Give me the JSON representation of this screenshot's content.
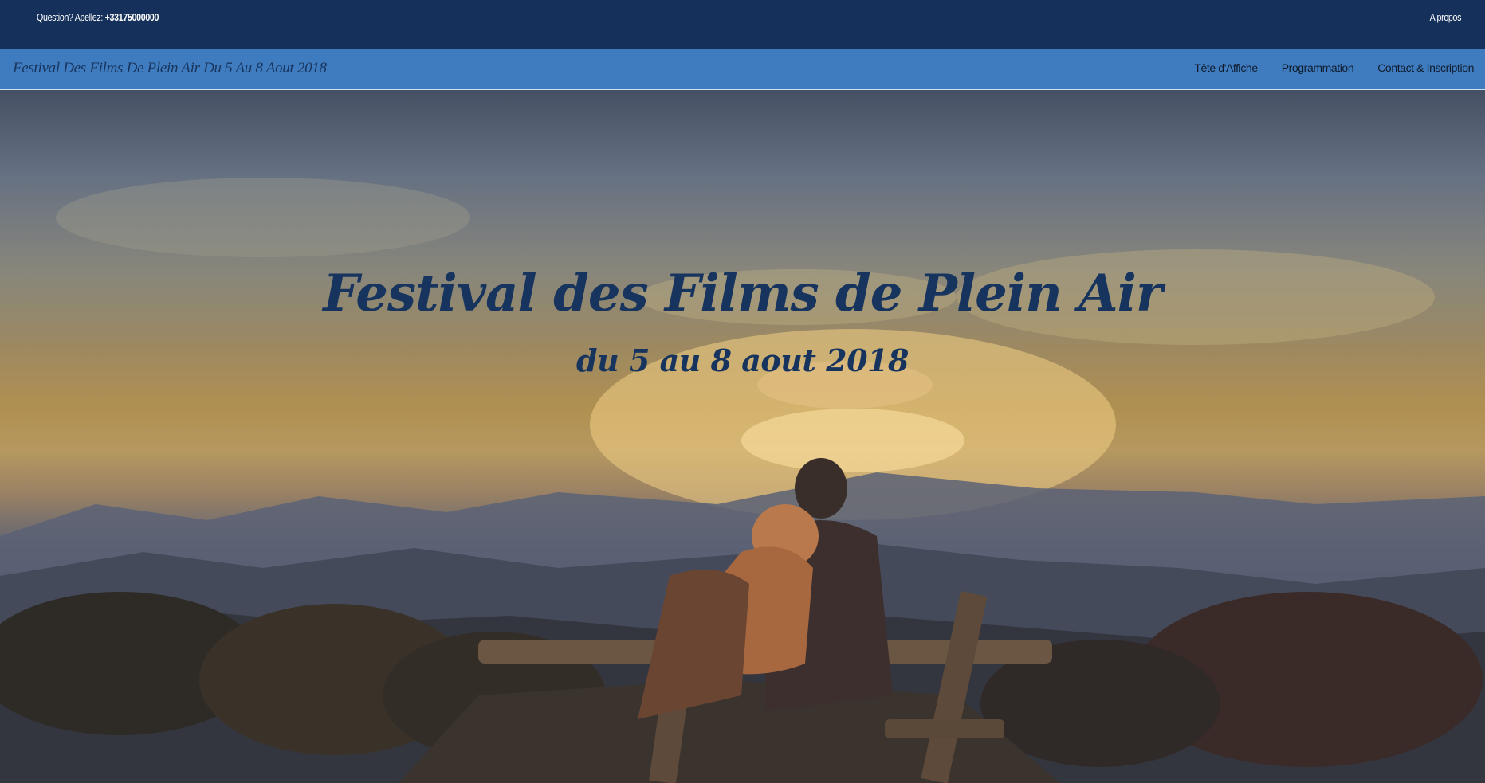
{
  "top_bar": {
    "contact_prefix": "Question? Apellez: ",
    "phone": "+33175000000",
    "about_link": "A propos"
  },
  "nav": {
    "brand": "Festival Des Films De Plein Air Du 5 Au 8 Aout 2018",
    "items": [
      {
        "label": "Tête d'Affiche"
      },
      {
        "label": "Programmation"
      },
      {
        "label": "Contact & Inscription"
      }
    ]
  },
  "hero": {
    "title": "Festival des Films de Plein Air",
    "subtitle": "du 5 au 8 aout 2018",
    "image_description_icon": "sunset-couple-bench-photo"
  },
  "colors": {
    "top_bar_bg": "#15305a",
    "nav_bar_bg": "#3f7cbf",
    "hero_text": "#17345e"
  }
}
